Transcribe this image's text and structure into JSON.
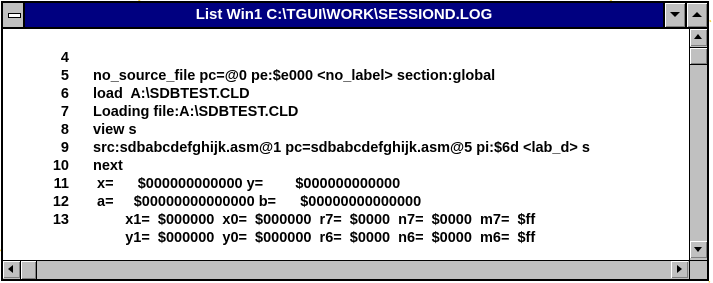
{
  "window": {
    "title": "List Win1 C:\\TGUI\\WORK\\SESSIOND.LOG"
  },
  "colors": {
    "titlebar": "#000080",
    "titlebar_text": "#ffffff",
    "chrome": "#c0c0c0",
    "text": "#000000",
    "background_dots": "#f2d24a"
  },
  "icons": {
    "system_menu": "system-menu-icon",
    "minimize": "minimize-icon",
    "maximize": "maximize-icon",
    "scroll_up": "scroll-up-arrow-icon",
    "scroll_down": "scroll-down-arrow-icon",
    "scroll_left": "scroll-left-arrow-icon",
    "scroll_right": "scroll-right-arrow-icon"
  },
  "lines": [
    {
      "num": "4",
      "text": "no_source_file pc=@0 pe:$e000 <no_label> section:global"
    },
    {
      "num": "5",
      "text": "load  A:\\SDBTEST.CLD"
    },
    {
      "num": "6",
      "text": "Loading file:A:\\SDBTEST.CLD"
    },
    {
      "num": "7",
      "text": "view s"
    },
    {
      "num": "8",
      "text": "src:sdbabcdefghijk.asm@1 pc=sdbabcdefghijk.asm@5 pi:$6d <lab_d> s"
    },
    {
      "num": "9",
      "text": "next"
    },
    {
      "num": "10",
      "text": " x=      $000000000000 y=        $000000000000"
    },
    {
      "num": "11",
      "text": " a=     $00000000000000 b=      $00000000000000"
    },
    {
      "num": "12",
      "text": "        x1=  $000000  x0=  $000000  r7=  $0000  n7=  $0000  m7=  $ff"
    },
    {
      "num": "13",
      "text": "        y1=  $000000  y0=  $000000  r6=  $0000  n6=  $0000  m6=  $ff"
    }
  ]
}
